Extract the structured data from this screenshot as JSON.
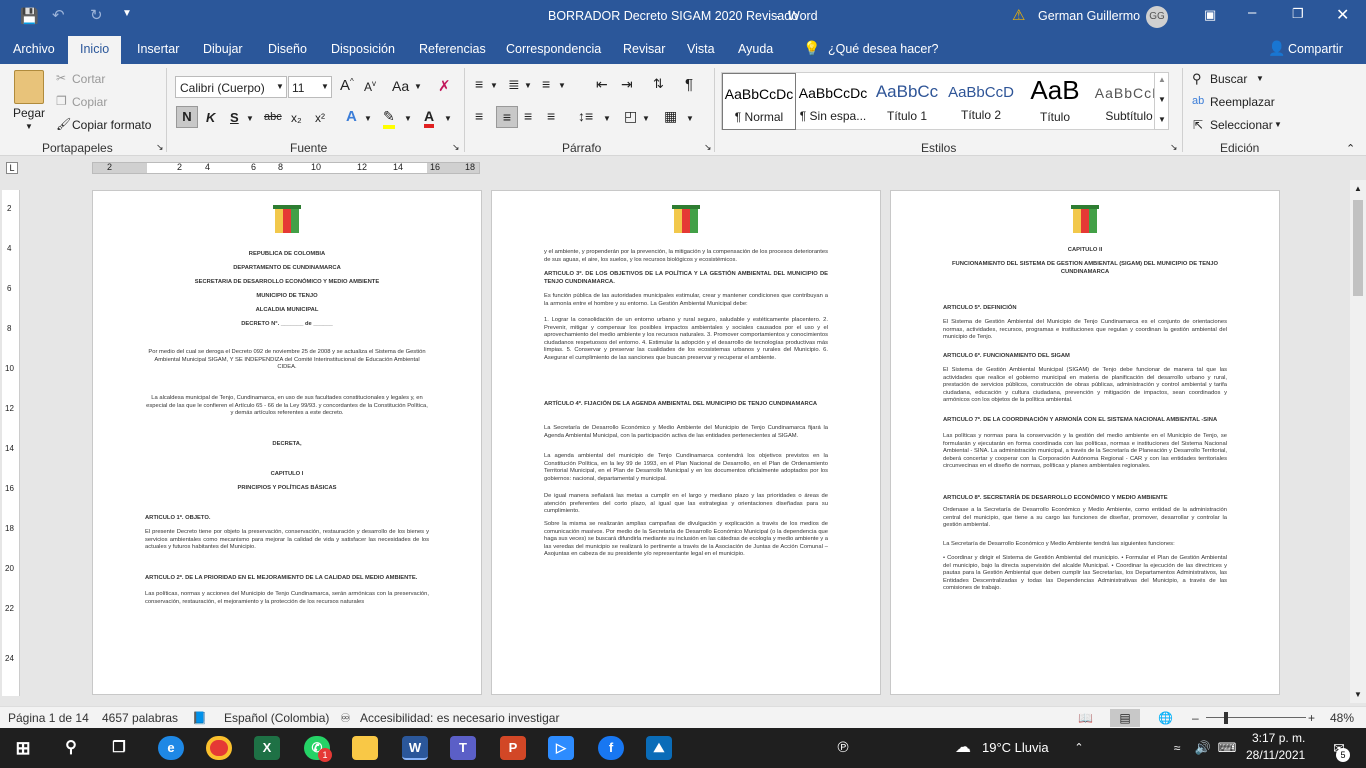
{
  "titlebar": {
    "doc_title": "BORRADOR Decreto SIGAM 2020 Revisado",
    "separator": "-",
    "app": "Word",
    "user": "German Guillermo",
    "user_initials": "GG"
  },
  "tabs": [
    "Archivo",
    "Inicio",
    "Insertar",
    "Dibujar",
    "Diseño",
    "Disposición",
    "Referencias",
    "Correspondencia",
    "Revisar",
    "Vista",
    "Ayuda"
  ],
  "active_tab": "Inicio",
  "tell_me": "¿Qué desea hacer?",
  "share": "Compartir",
  "clipboard": {
    "paste": "Pegar",
    "cut": "Cortar",
    "copy": "Copiar",
    "format_painter": "Copiar formato",
    "label": "Portapapeles"
  },
  "font": {
    "name": "Calibri (Cuerpo)",
    "size": "11",
    "label": "Fuente",
    "bold": "N",
    "italic": "K",
    "underline": "S",
    "strike": "abc",
    "sub": "x₂",
    "sup": "x²",
    "aa": "Aa"
  },
  "paragraph": {
    "label": "Párrafo"
  },
  "styles": {
    "label": "Estilos",
    "items": [
      {
        "preview": "AaBbCcDc",
        "name": "¶ Normal"
      },
      {
        "preview": "AaBbCcDc",
        "name": "¶ Sin espa..."
      },
      {
        "preview": "AaBbCc",
        "name": "Título 1"
      },
      {
        "preview": "AaBbCcD",
        "name": "Título 2"
      },
      {
        "preview": "AaB",
        "name": "Título"
      },
      {
        "preview": "AaBbCcD",
        "name": "Subtítulo"
      }
    ]
  },
  "editing": {
    "find": "Buscar",
    "replace": "Reemplazar",
    "select": "Seleccionar",
    "label": "Edición"
  },
  "ruler_marks": [
    "2",
    "2",
    "4",
    "6",
    "8",
    "10",
    "12",
    "14",
    "16",
    "18"
  ],
  "vruler_marks": [
    "2",
    "4",
    "6",
    "8",
    "10",
    "12",
    "14",
    "16",
    "18",
    "20",
    "22",
    "24"
  ],
  "pages": [
    {
      "blocks": [
        {
          "t": "REPUBLICA DE COLOMBIA",
          "c": 1,
          "b": 1
        },
        {
          "t": "DEPARTAMENTO DE CUNDINAMARCA",
          "c": 1,
          "b": 1
        },
        {
          "t": "SECRETARIA DE DESARROLLO ECONÓMICO Y MEDIO AMBIENTE",
          "c": 1,
          "b": 1
        },
        {
          "t": "MUNICIPIO DE TENJO",
          "c": 1,
          "b": 1
        },
        {
          "t": "ALCALDIA MUNICIPAL",
          "c": 1,
          "b": 1
        },
        {
          "t": "DECRETO N°. _______ de ______",
          "c": 1,
          "b": 1
        },
        {
          "t": "Por medio del cual se deroga el Decreto 092 de noviembre 25 de 2008 y se actualiza el Sistema de Gestión Ambiental Municipal SIGAM, Y SE INDEPENDIZA del Comité Interinstitucional de Educación Ambiental CIDEA.",
          "c": 1
        },
        {
          "t": "La alcaldesa municipal de Tenjo, Cundinamarca, en uso de sus facultades constitucionales y legales y, en especial de las que le confieren el Artículo 65 - 66 de la Ley 99/93. y concordantes de la Constitución Política, y demás artículos referentes a este decreto.",
          "c": 1
        },
        {
          "t": "DECRETA,",
          "c": 1,
          "b": 1
        },
        {
          "t": "CAPITULO I",
          "c": 1,
          "b": 1
        },
        {
          "t": "PRINCIPIOS Y POLÍTICAS BÁSICAS",
          "c": 1,
          "b": 1
        },
        {
          "t": "ARTICULO 1º. OBJETO.",
          "b": 1
        },
        {
          "t": "El presente Decreto tiene por objeto la preservación, conservación, restauración y desarrollo de los bienes y servicios ambientales como mecanismo para mejorar la calidad de vida y satisfacer las necesidades de los actuales y futuros habitantes del Municipio."
        },
        {
          "t": "ARTICULO 2º. DE LA PRIORIDAD EN EL MEJORAMIENTO DE LA CALIDAD DEL MEDIO AMBIENTE.",
          "b": 1
        },
        {
          "t": "Las políticas, normas y acciones del Municipio de Tenjo Cundinamarca, serán armónicas con la preservación, conservación, restauración, el mejoramiento y la protección de los recursos naturales"
        }
      ]
    },
    {
      "blocks": [
        {
          "t": "y el ambiente, y propenderán por la prevención, la mitigación y la compensación de los procesos deteriorantes de sus aguas, el aire, los suelos, y los recursos biológicos y ecosistémicos."
        },
        {
          "t": "ARTICULO 3º. DE LOS OBJETIVOS DE LA POLÍTICA Y LA GESTIÓN AMBIENTAL DEL MUNICIPIO DE TENJO CUNDINAMARCA.",
          "b": 1
        },
        {
          "t": "Es función pública de las autoridades municipales estimular, crear y mantener condiciones que contribuyan a la armonía entre el hombre y su entorno. La Gestión Ambiental Municipal debe:"
        },
        {
          "t": "1. Lograr la consolidación de un entorno urbano y rural seguro, saludable y estéticamente placentero. 2. Prevenir, mitigar y compensar los posibles impactos ambientales y sociales causados por el uso y el aprovechamiento del medio ambiente y los recursos naturales. 3. Promover comportamientos y conocimientos ciudadanos respetuosos del entorno. 4. Estimular la adopción y el desarrollo de tecnologías productivas más limpias. 5. Conservar y preservar las cualidades de los ecosistemas urbanos y rurales del Municipio. 6. Asegurar el cumplimiento de las sanciones que buscan preservar y recuperar el ambiente."
        },
        {
          "t": "ARTÍCULO 4º. FIJACIÓN DE LA AGENDA AMBIENTAL DEL MUNICIPIO DE TENJO CUNDINAMARCA",
          "b": 1
        },
        {
          "t": "La Secretaría de Desarrollo Económico y Medio Ambiente del Municipio de Tenjo Cundinamarca fijará la Agenda Ambiental Municipal, con la participación activa de las entidades pertenecientes al SIGAM."
        },
        {
          "t": "La agenda ambiental del municipio de Tenjo Cundinamarca contendrá los objetivos previstos en la Constitución Política, en la ley 99 de 1993, en el Plan Nacional de Desarrollo, en el Plan de Ordenamiento Territorial Municipal, en el Plan de Desarrollo Municipal y en los documentos oficialmente adoptados por los gobiernos: nacional, departamental y municipal."
        },
        {
          "t": "De igual manera señalará las metas a cumplir en el largo y mediano plazo y las prioridades o áreas de atención preferentes del corto plazo, al igual que las estrategias y orientaciones diseñadas para su cumplimiento."
        },
        {
          "t": "Sobre la misma se realizarán amplias campañas de divulgación y explicación a través de los medios de comunicación masivos. Por medio de la Secretaría de Desarrollo Económico Municipal (o la dependencia que haga sus veces) se buscará difundirla mediante su inclusión en las cátedras de ecología y medio ambiente y a las veredas del municipio se realizará lo pertinente a través de la Asociación de Juntas de Acción Comunal – Asojuntas en cabeza de su presidente y/o representante legal en el municipio."
        }
      ]
    },
    {
      "blocks": [
        {
          "t": "CAPITULO II",
          "c": 1,
          "b": 1
        },
        {
          "t": "FUNCIONAMIENTO DEL SISTEMA DE GESTION AMBIENTAL (SIGAM) DEL MUNICIPIO DE TENJO CUNDINAMARCA",
          "c": 1,
          "b": 1
        },
        {
          "t": "ARTICULO 5º. DEFINICIÓN",
          "b": 1
        },
        {
          "t": "El Sistema de Gestión Ambiental del Municipio de Tenjo Cundinamarca es el conjunto de orientaciones normas, actividades, recursos, programas e instituciones que regulan y coordinan la gestión ambiental del municipio de Tenjo."
        },
        {
          "t": "ARTICULO 6º. FUNCIONAMIENTO DEL SIGAM",
          "b": 1
        },
        {
          "t": "El Sistema de Gestión Ambiental Municipal (SIGAM) de Tenjo debe funcionar de manera tal que las actividades que realice el gobierno municipal en materia de planificación del desarrollo urbano y rural, prestación de servicios públicos, construcción de obras públicas, administración y control ambiental y tarifa ciudadana, educación y cultura ciudadana, prevención y mitigación de impactos, sean coordinados y armónicos con los objetos de la política ambiental."
        },
        {
          "t": "ARTICULO 7º. DE LA COORDINACIÓN Y ARMONÍA CON EL SISTEMA NACIONAL AMBIENTAL -SINA",
          "b": 1
        },
        {
          "t": "Las políticas y normas para la conservación y la gestión del medio ambiente en el Municipio de Tenjo, se formularán y ejecutarán en forma coordinada con las políticas, normas e instituciones del Sistema Nacional Ambiental - SINA. La administración municipal, a través de la Secretaría de Planeación y Desarrollo Territorial, deberá concertar y cooperar con la Corporación Autónoma Regional - CAR y con las entidades territoriales circunvecinas en el diseño de normas, políticas y planes ambientales regionales."
        },
        {
          "t": "ARTICULO 8º. SECRETARÍA DE DESARROLLO ECONÓMICO Y MEDIO AMBIENTE",
          "b": 1
        },
        {
          "t": "Ordenase a la Secretaría de Desarrollo Económico y Medio Ambiente, como entidad de la administración central del municipio, que tiene a su cargo las funciones de diseñar, promover, desarrollar y controlar la gestión ambiental."
        },
        {
          "t": "La Secretaría de Desarrollo Económico y Medio Ambiente tendrá las siguientes funciones:"
        },
        {
          "t": "• Coordinar y dirigir el Sistema de Gestión Ambiental del municipio. • Formular el Plan de Gestión Ambiental del municipio, bajo la directa supervisión del alcalde Municipal. • Coordinar la ejecución de las directrices y pautas para la Gestión Ambiental que deben cumplir las Secretarías, los Departamentos Administrativos, las Entidades Descentralizadas y todas las Dependencias Administrativas del Municipio, a través de las comisiones de trabajo."
        }
      ]
    }
  ],
  "status": {
    "page": "Página 1 de 14",
    "words": "4657 palabras",
    "language": "Español (Colombia)",
    "accessibility": "Accesibilidad: es necesario investigar",
    "zoom": "48%"
  },
  "taskbar": {
    "weather": "19°C  Lluvia",
    "time": "3:17 p. m.",
    "date": "28/11/2021",
    "notifications": "5",
    "whatsapp_badge": "1"
  }
}
